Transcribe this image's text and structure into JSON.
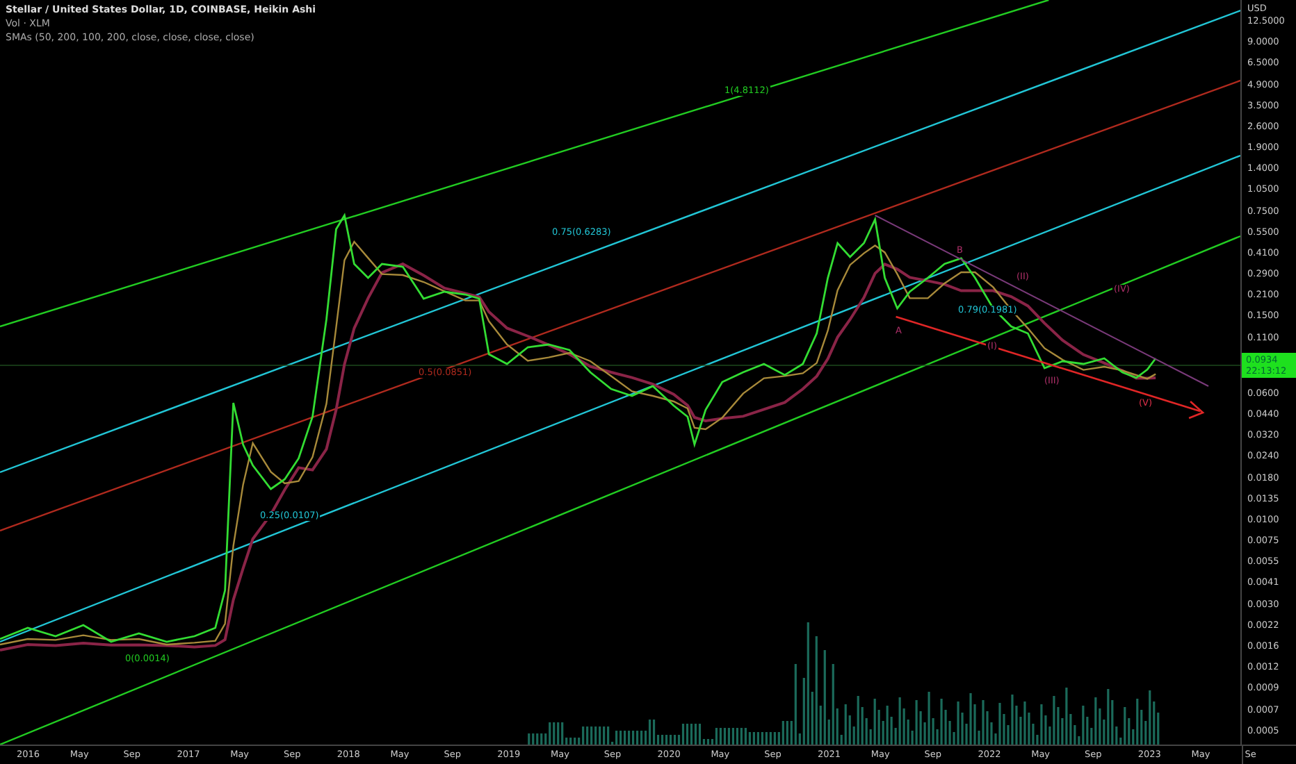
{
  "legend": {
    "title": "Stellar / United States Dollar, 1D, COINBASE, Heikin Ashi",
    "volume": "Vol · XLM",
    "smas": "SMAs (50, 200, 100, 200, close, close, close, close)"
  },
  "annotations": [
    {
      "text": "1(4.8112)",
      "color": "#22cc22"
    },
    {
      "text": "0.75(0.6283)",
      "color": "#22c6d6"
    },
    {
      "text": "0.5(0.0851)",
      "color": "#b02a1e"
    },
    {
      "text": "0.25(0.0107)",
      "color": "#22c6d6"
    },
    {
      "text": "0(0.0014)",
      "color": "#22cc22"
    },
    {
      "text": "0.79(0.1981)",
      "color": "#22c6d6"
    },
    {
      "text": "A",
      "color": "#b0306a"
    },
    {
      "text": "B",
      "color": "#b0306a"
    },
    {
      "text": "(I)",
      "color": "#b0306a"
    },
    {
      "text": "(II)",
      "color": "#b0306a"
    },
    {
      "text": "(III)",
      "color": "#b0306a"
    },
    {
      "text": "(IV)",
      "color": "#b0306a"
    },
    {
      "text": "(V)",
      "color": "#e0304a"
    }
  ],
  "price_axis": {
    "currency": "USD",
    "ticks": [
      "12.5000",
      "9.0000",
      "6.5000",
      "4.9000",
      "3.5000",
      "2.6000",
      "1.9000",
      "1.4000",
      "1.0500",
      "0.7500",
      "0.5500",
      "0.4100",
      "0.2900",
      "0.2100",
      "0.1500",
      "0.1100",
      "0.0600",
      "0.0440",
      "0.0320",
      "0.0240",
      "0.0180",
      "0.0135",
      "0.0100",
      "0.0075",
      "0.0055",
      "0.0041",
      "0.0030",
      "0.0022",
      "0.0016",
      "0.0012",
      "0.0009",
      "0.0007",
      "0.0005"
    ],
    "last_price": "0.0934",
    "countdown": "22:13:12"
  },
  "time_axis": [
    "2016",
    "May",
    "Sep",
    "2017",
    "May",
    "Sep",
    "2018",
    "May",
    "Sep",
    "2019",
    "May",
    "Sep",
    "2020",
    "May",
    "Sep",
    "2021",
    "May",
    "Sep",
    "2022",
    "May",
    "Sep",
    "2023",
    "May",
    "Se"
  ]
}
